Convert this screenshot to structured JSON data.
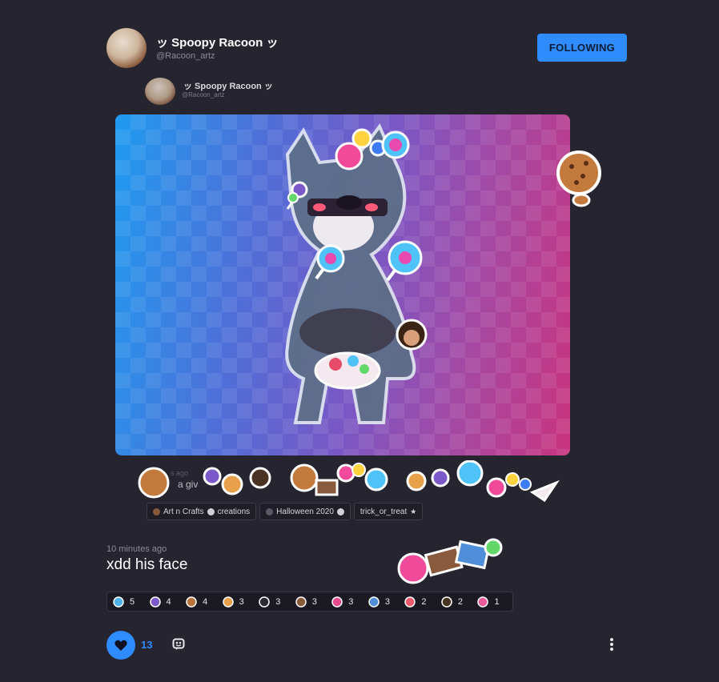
{
  "header": {
    "display_name": "ッ Spoopy Racoon ッ",
    "handle": "@Racoon_artz",
    "follow_label": "FOLLOWING"
  },
  "embedded_post": {
    "display_name": "ッ Spoopy Racoon ッ",
    "handle": "@Racoon_artz",
    "partial_time": "s ago",
    "partial_text": "a giv",
    "tags": [
      {
        "label": "Art n Crafts",
        "suffix": "creations"
      },
      {
        "label": "Halloween 2020",
        "suffix": "trick_or_treat"
      }
    ]
  },
  "post": {
    "timestamp": "10 minutes ago",
    "caption": "xdd his face"
  },
  "reactions": [
    {
      "icon": "lollipop-icon",
      "count": "5",
      "color": "#4fb3e8"
    },
    {
      "icon": "candy-bouquet-icon",
      "count": "4",
      "color": "#7b59c9"
    },
    {
      "icon": "cookie-icon",
      "count": "4",
      "color": "#b8733c"
    },
    {
      "icon": "candy-wrapper-icon",
      "count": "3",
      "color": "#e8a04a"
    },
    {
      "icon": "bat-icon",
      "count": "3",
      "color": "#2a2833"
    },
    {
      "icon": "chocolate-bar-icon",
      "count": "3",
      "color": "#8a5a3c"
    },
    {
      "icon": "gumballs-icon",
      "count": "3",
      "color": "#e84a8f"
    },
    {
      "icon": "candy-box-icon",
      "count": "3",
      "color": "#4f8fd9"
    },
    {
      "icon": "red-lollipop-icon",
      "count": "2",
      "color": "#ef5a6f"
    },
    {
      "icon": "cauldron-icon",
      "count": "2",
      "color": "#4a3322"
    },
    {
      "icon": "balloons-icon",
      "count": "1",
      "color": "#e85a9a"
    }
  ],
  "actions": {
    "like_count": "13"
  },
  "colors": {
    "accent": "#2f8cff",
    "background": "#26242e"
  }
}
